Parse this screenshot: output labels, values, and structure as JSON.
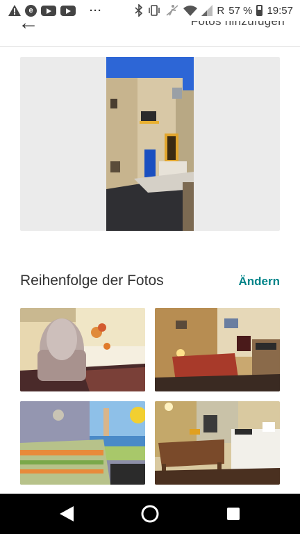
{
  "status_bar": {
    "carrier_indicator": "R",
    "battery_percent": "57 %",
    "time": "19:57",
    "more_label": "···",
    "icons": [
      "warning-icon",
      "circle-e-icon",
      "youtube-icon",
      "youtube-icon",
      "bluetooth-icon",
      "vibrate-icon",
      "no-accessibility-icon",
      "wifi-icon",
      "signal-icon",
      "battery-icon"
    ]
  },
  "header": {
    "back_icon": "arrow-left-icon",
    "action_label": "Fotos hinzufügen"
  },
  "main_photo": {
    "alt_icon": "house-photo"
  },
  "photo_order": {
    "title": "Reihenfolge der Fotos",
    "change_label": "Ändern",
    "accent_color": "#008489"
  },
  "thumbnails": [
    "armchair-photo",
    "dining-room-photo",
    "bedroom-photo",
    "kitchen-photo"
  ],
  "nav_bar": {
    "icons": [
      "back-triangle-icon",
      "home-circle-icon",
      "recents-square-icon"
    ]
  }
}
